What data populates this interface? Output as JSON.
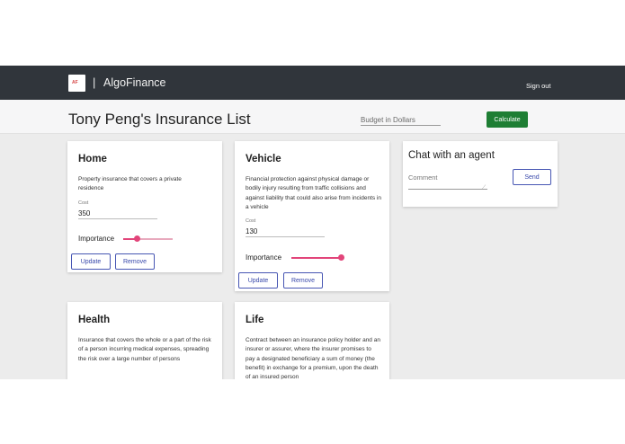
{
  "topbar": {
    "logo_text": "AF",
    "separator": "|",
    "app_name": "AlgoFinance",
    "signout_label": "Sign out"
  },
  "subbar": {
    "page_title": "Tony Peng's Insurance List",
    "budget_placeholder": "Budget in Dollars",
    "calculate_label": "Calculate"
  },
  "cards": [
    {
      "title": "Home",
      "description": "Property insurance that covers a private residence",
      "cost_label": "Cost",
      "cost_value": "350",
      "importance_label": "Importance",
      "importance_fraction": 0.28,
      "update_label": "Update",
      "remove_label": "Remove"
    },
    {
      "title": "Vehicle",
      "description": "Financial protection against physical damage or bodily injury resulting from traffic collisions and against liability that could also arise from incidents in a vehicle",
      "cost_label": "Cost",
      "cost_value": "130",
      "importance_label": "Importance",
      "importance_fraction": 1.0,
      "update_label": "Update",
      "remove_label": "Remove"
    },
    {
      "title": "Health",
      "description": "Insurance that covers the whole or a part of the risk of a person incurring medical expenses, spreading the risk over a large number of persons"
    },
    {
      "title": "Life",
      "description": "Contract between an insurance policy holder and an insurer or assurer, where the insurer promises to pay a designated beneficiary a sum of money (the benefit) in exchange for a premium, upon the death of an insured person"
    }
  ],
  "chat": {
    "title": "Chat with an agent",
    "comment_placeholder": "Comment",
    "send_label": "Send"
  },
  "colors": {
    "topbar": "#30353b",
    "calculate_button": "#1e7e34",
    "slider_accent": "#e2457a",
    "outline_button": "#3949ab"
  }
}
